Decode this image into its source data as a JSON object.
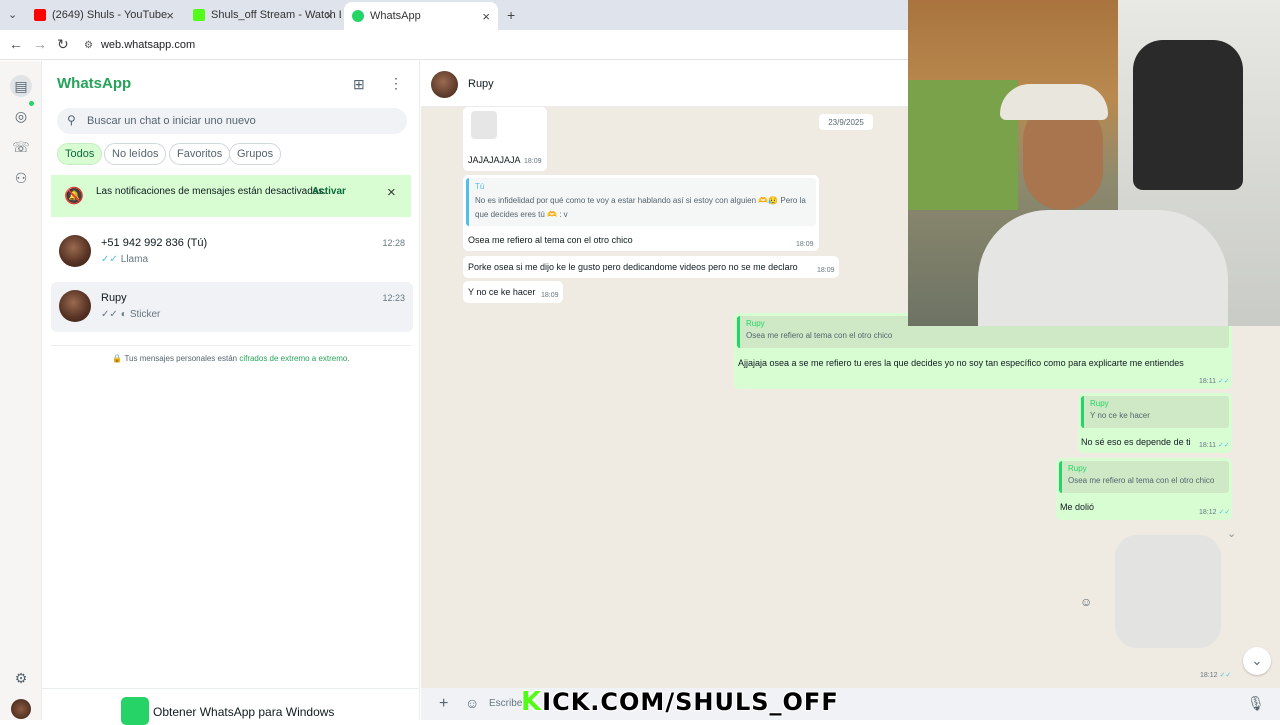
{
  "browser": {
    "tabs": [
      {
        "label": "(2649) Shuls - YouTube",
        "icon": "youtube-icon",
        "color": "#ff0000"
      },
      {
        "label": "Shuls_off Stream - Watch Live o",
        "icon": "kick-icon",
        "color": "#53fc18"
      },
      {
        "label": "WhatsApp",
        "icon": "whatsapp-icon",
        "color": "#25d366"
      }
    ],
    "new_tab": "+",
    "url": "web.whatsapp.com"
  },
  "app": {
    "title": "WhatsApp",
    "search_placeholder": "Buscar un chat o iniciar uno nuevo",
    "filters": [
      "Todos",
      "No leídos",
      "Favoritos",
      "Grupos"
    ],
    "active_filter": "Todos",
    "notification": {
      "text": "Las notificaciones de mensajes están desactivadas.",
      "action": "Activar"
    },
    "chats": [
      {
        "name": "+51 942 992 836 (Tú)",
        "time": "12:28",
        "preview": "Llama",
        "ticks": "✓✓"
      },
      {
        "name": "Rupy",
        "time": "12:23",
        "preview": "Sticker",
        "ticks": "✓✓"
      }
    ],
    "encryption_note": {
      "prefix": "Tus mensajes personales están ",
      "link": "cifrados de extremo a extremo",
      "suffix": "."
    },
    "get_app": "Obtener WhatsApp para Windows"
  },
  "conversation": {
    "contact": "Rupy",
    "date_chip": "23/9/2025",
    "messages": [
      {
        "dir": "in",
        "text": "JAJAJAJAJA",
        "time": "18:09"
      },
      {
        "dir": "in",
        "quote_name": "Tú",
        "quote_text": "No es infidelidad por qué como te voy a estar hablando así si estoy con alguien 🫶😥 Pero la que decides eres tú 🫶 : v",
        "text": "Osea me refiero al tema con el otro chico",
        "time": "18:09"
      },
      {
        "dir": "in",
        "text": "Porke osea si me dijo ke le gusto pero dedicandome videos pero no se me declaro",
        "time": "18:09"
      },
      {
        "dir": "in",
        "text": "Y no ce ke hacer",
        "time": "18:09"
      },
      {
        "dir": "out",
        "quote_name": "Rupy",
        "quote_text": "Osea me refiero al tema con el otro chico",
        "text": "Ajjajaja  osea a se me refiero tu eres la que decides yo no soy tan específico como para explicarte me entiendes",
        "time": "18:11"
      },
      {
        "dir": "out",
        "quote_name": "Rupy",
        "quote_text": "Y no ce ke hacer",
        "text": "No sé eso es depende de ti",
        "time": "18:11"
      },
      {
        "dir": "out",
        "quote_name": "Rupy",
        "quote_text": "Osea me refiero al tema con el otro chico",
        "text": "Me dolió",
        "time": "18:12"
      },
      {
        "dir": "out",
        "sticker": true,
        "time": "18:12"
      }
    ],
    "composer_placeholder": "Escribe"
  },
  "overlay": {
    "kick_url": "KICK.COM/SHULS_OFF",
    "kick_color": "#53fc18"
  },
  "colors": {
    "accent": "#25a35a",
    "outgoing_bubble": "#d9fdd3",
    "chat_bg": "#efeae2",
    "read_tick": "#53bdeb"
  }
}
